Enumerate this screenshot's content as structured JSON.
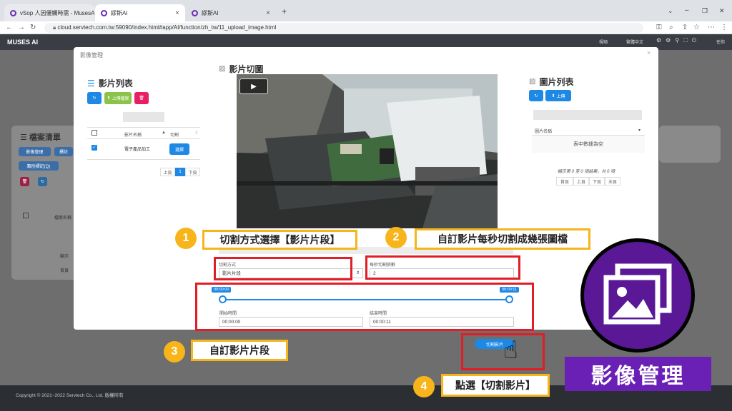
{
  "browser": {
    "tabs": [
      {
        "title": "vSop 人因優觸時需 - MusesAI"
      },
      {
        "title": "繆斯AI"
      },
      {
        "title": "繆斯AI"
      }
    ],
    "new_tab_symbol": "+",
    "url": "cloud.servtech.com.tw:59090/index.html#app/AI/function/zh_tw/11_upload_image.html",
    "window_controls": {
      "min": "–",
      "max": "❐",
      "close": "✕"
    }
  },
  "app": {
    "logo": "MUSES AI",
    "header_right": [
      "視頻",
      "繁體中文",
      "任你"
    ],
    "copyright": "Copyright © 2021~2022 Servtech Co., Ltd. 版權所有"
  },
  "background_panel": {
    "title": "檔案清單",
    "buttons": [
      "影像管理",
      "標註",
      "類別標記(Q)"
    ],
    "table_header": "檔案名稱",
    "paging": "顯示",
    "first_page": "首頁"
  },
  "modal": {
    "title": "影像管理",
    "close": "×",
    "video_list": {
      "title": "影片列表",
      "upload_button": "上傳檔案",
      "columns": {
        "name": "影片名稱",
        "action": "切割"
      },
      "rows": [
        {
          "name": "電子產品加工",
          "action": "選擇"
        }
      ],
      "pagination": {
        "prev": "上頁",
        "current": "1",
        "next": "下頁"
      }
    },
    "video_cut": {
      "title": "影片切圖",
      "method_label": "切割方式",
      "method_value": "影片片段",
      "fps_label": "每秒切割張數",
      "fps_value": "2",
      "range_start_label": "00:00:00",
      "range_end_label": "00:00:11",
      "start_time_label": "開始時間",
      "start_time_value": "00:00:00",
      "end_time_label": "結束時間",
      "end_time_value": "00:00:11",
      "cut_button": "切割影片"
    },
    "image_list": {
      "title": "圖片列表",
      "upload_button": "上傳",
      "column": "圖片名稱",
      "empty": "表中數據為空",
      "summary": "顯示第 0 至 0 項結果，共 0 項",
      "pagination": [
        "首頁",
        "上頁",
        "下頁",
        "末頁"
      ]
    }
  },
  "callouts": [
    {
      "num": "1",
      "text": "切割方式選擇【影片片段】"
    },
    {
      "num": "2",
      "text": "自訂影片每秒切割成幾張圖檔"
    },
    {
      "num": "3",
      "text": "自訂影片片段"
    },
    {
      "num": "4",
      "text": "點選【切割影片】"
    }
  ],
  "badge": {
    "label": "影像管理",
    "icon": "image-gallery-icon"
  },
  "colors": {
    "accent_blue": "#1e88e5",
    "callout_yellow": "#f5b51b",
    "highlight_red": "#e21d26",
    "badge_purple": "#6a1fb5"
  }
}
